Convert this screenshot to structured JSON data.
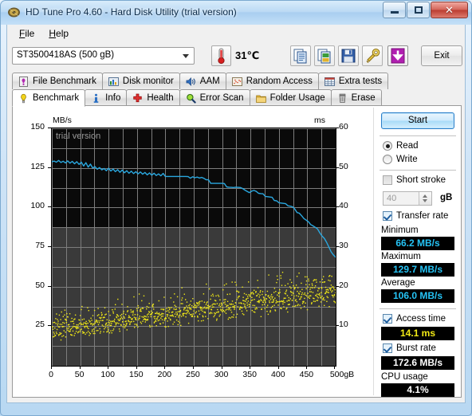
{
  "window": {
    "title": "HD Tune Pro 4.60 - Hard Disk Utility (trial version)",
    "icon": "hdtune-app-icon",
    "minimize_label": "",
    "maximize_label": "",
    "close_label": "✕"
  },
  "menu": {
    "items": [
      {
        "label": "File",
        "accel": "F"
      },
      {
        "label": "Help",
        "accel": "H"
      }
    ]
  },
  "toolbar": {
    "drive": "ST3500418AS (500 gB)",
    "drive_arrow_icon": "chevron-down-icon",
    "temperature": "31℃",
    "thermometer_icon": "thermometer-icon",
    "buttons": [
      {
        "name": "copy-text-button",
        "icon": "copy-document-icon"
      },
      {
        "name": "copy-image-button",
        "icon": "copy-image-icon"
      },
      {
        "name": "save-button",
        "icon": "floppy-disk-icon"
      },
      {
        "name": "options-button",
        "icon": "wrench-icon"
      },
      {
        "name": "download-button",
        "icon": "download-arrow-icon"
      }
    ],
    "exit_label": "Exit"
  },
  "tabs": {
    "row1": [
      {
        "label": "File Benchmark",
        "icon": "file-benchmark-icon",
        "active": false
      },
      {
        "label": "Disk monitor",
        "icon": "bar-chart-icon",
        "active": false
      },
      {
        "label": "AAM",
        "icon": "speaker-icon",
        "active": false
      },
      {
        "label": "Random Access",
        "icon": "random-access-icon",
        "active": false
      },
      {
        "label": "Extra tests",
        "icon": "extra-tests-icon",
        "active": false
      }
    ],
    "row2": [
      {
        "label": "Benchmark",
        "icon": "lightbulb-icon",
        "active": true
      },
      {
        "label": "Info",
        "icon": "info-icon",
        "active": false
      },
      {
        "label": "Health",
        "icon": "red-cross-icon",
        "active": false
      },
      {
        "label": "Error Scan",
        "icon": "magnifier-icon",
        "active": false
      },
      {
        "label": "Folder Usage",
        "icon": "folder-icon",
        "active": false
      },
      {
        "label": "Erase",
        "icon": "trash-icon",
        "active": false
      }
    ]
  },
  "panel": {
    "start_label": "Start",
    "mode": {
      "read_label": "Read",
      "write_label": "Write",
      "read_selected": true,
      "write_selected": false
    },
    "short_stroke": {
      "label": "Short stroke",
      "checked": false,
      "value": "40",
      "unit": "gB"
    },
    "transfer_rate": {
      "label": "Transfer rate",
      "checked": true,
      "minimum_label": "Minimum",
      "minimum_value": "66.2 MB/s",
      "maximum_label": "Maximum",
      "maximum_value": "129.7 MB/s",
      "average_label": "Average",
      "average_value": "106.0 MB/s"
    },
    "access_time": {
      "label": "Access time",
      "checked": true,
      "value": "14.1 ms"
    },
    "burst_rate": {
      "label": "Burst rate",
      "checked": true,
      "value": "172.6 MB/s"
    },
    "cpu_usage": {
      "label": "CPU usage",
      "value": "4.1%"
    }
  },
  "chart_data": {
    "type": "line",
    "title": "",
    "watermark": "trial version",
    "xlabel": "",
    "ylabel": "MB/s",
    "y2label": "ms",
    "xlim": [
      0,
      500
    ],
    "ylim": [
      0,
      150
    ],
    "y2lim": [
      0,
      60
    ],
    "grid": true,
    "xticks": [
      0,
      50,
      100,
      150,
      200,
      250,
      300,
      350,
      400,
      450,
      500
    ],
    "xticklabels": [
      "0",
      "50",
      "100",
      "150",
      "200",
      "250",
      "300",
      "350",
      "400",
      "450",
      "500gB"
    ],
    "yticks": [
      0,
      25,
      50,
      75,
      100,
      125,
      150
    ],
    "yticklabels": [
      "0",
      "25",
      "50",
      "75",
      "100",
      "125",
      "150"
    ],
    "y2ticks": [
      0,
      10,
      20,
      30,
      40,
      50,
      60
    ],
    "y2ticklabels": [
      "0",
      "10",
      "20",
      "30",
      "40",
      "50",
      "60"
    ],
    "colors": {
      "transfer_rate": "#2aa8e0",
      "access_time": "#f2ea16",
      "plot_background": "#3a3a3a",
      "plot_background_top": "#0a0a0a",
      "gridline": "#7d7d7d"
    },
    "series": [
      {
        "name": "Transfer rate",
        "axis": "left",
        "unit": "MB/s",
        "type": "line",
        "x": [
          0,
          4,
          8,
          12,
          16,
          20,
          24,
          28,
          32,
          36,
          40,
          44,
          48,
          52,
          56,
          60,
          64,
          68,
          72,
          76,
          80,
          84,
          88,
          92,
          96,
          100,
          104,
          108,
          112,
          116,
          120,
          124,
          128,
          132,
          136,
          140,
          144,
          148,
          152,
          156,
          160,
          164,
          168,
          172,
          176,
          180,
          184,
          188,
          192,
          196,
          200,
          204,
          208,
          212,
          216,
          220,
          224,
          228,
          232,
          236,
          240,
          244,
          248,
          252,
          256,
          260,
          264,
          268,
          272,
          276,
          280,
          284,
          288,
          292,
          296,
          300,
          304,
          308,
          312,
          316,
          320,
          324,
          328,
          332,
          336,
          340,
          344,
          348,
          352,
          356,
          360,
          364,
          368,
          372,
          376,
          380,
          384,
          388,
          392,
          396,
          400,
          404,
          408,
          412,
          416,
          420,
          424,
          428,
          432,
          436,
          440,
          444,
          448,
          452,
          456,
          460,
          464,
          468,
          472,
          476,
          480,
          484,
          488,
          492,
          496,
          500
        ],
        "y": [
          128.8,
          129.3,
          128.6,
          129.7,
          128.4,
          129.2,
          128.1,
          129.4,
          128.0,
          129.1,
          127.6,
          128.9,
          127.2,
          128.6,
          126.2,
          128.3,
          125.5,
          127.4,
          124.9,
          125.8,
          124.2,
          125.2,
          123.8,
          124.6,
          123.2,
          124.8,
          123.0,
          124.3,
          122.6,
          123.9,
          122.2,
          123.6,
          121.9,
          123.2,
          121.6,
          122.9,
          121.4,
          122.6,
          121.2,
          122.4,
          121.0,
          122.1,
          120.6,
          121.8,
          120.4,
          121.6,
          120.2,
          121.2,
          120.0,
          121.5,
          119.6,
          119.6,
          119.6,
          119.6,
          119.6,
          119.6,
          119.6,
          119.6,
          119.6,
          119.6,
          119.5,
          118.5,
          119.4,
          118.8,
          119.2,
          118.6,
          119.0,
          118.4,
          117.5,
          117.5,
          115.2,
          115.2,
          115.2,
          115.2,
          115.2,
          115.2,
          115.1,
          113.0,
          112.8,
          112.7,
          112.6,
          112.8,
          112.7,
          112.6,
          112.0,
          111.0,
          110.2,
          109.4,
          110.3,
          110.8,
          110.2,
          109.0,
          108.8,
          108.6,
          107.0,
          106.8,
          106.6,
          106.4,
          104.4,
          104.2,
          103.0,
          102.8,
          102.6,
          102.4,
          101.0,
          100.8,
          100.4,
          99.0,
          96.8,
          96.4,
          94.8,
          93.0,
          92.0,
          91.0,
          89.2,
          88.4,
          87.5,
          86.5,
          84.0,
          82.0,
          80.5,
          78.0,
          75.0,
          72.0,
          70.0,
          68.5,
          67.0,
          66.2
        ]
      },
      {
        "name": "Access time",
        "axis": "right",
        "unit": "ms",
        "type": "scatter",
        "average": 14.1,
        "x_range": [
          0,
          500
        ],
        "y_range": [
          6.0,
          24.0
        ],
        "trend": "rising",
        "trend_start_ms": 10.5,
        "trend_end_ms": 20.5,
        "point_count": 1024
      }
    ]
  }
}
